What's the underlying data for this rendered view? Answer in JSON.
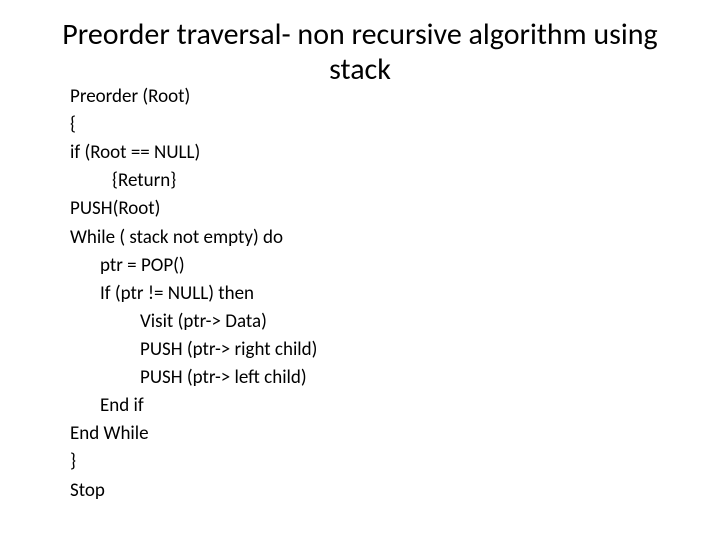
{
  "title": "Preorder traversal- non recursive algorithm using stack",
  "code": {
    "l1": "Preorder (Root)",
    "l2": "{",
    "l3": "if (Root == NULL)",
    "l4": "{Return}",
    "l5": "PUSH(Root)",
    "l6": "While ( stack not empty) do",
    "l7": "ptr = POP()",
    "l8": "If (ptr != NULL) then",
    "l9": "Visit (ptr-> Data)",
    "l10": "PUSH (ptr-> right child)",
    "l11": "PUSH (ptr-> left child)",
    "l12": "End if",
    "l13": "End While",
    "l14": "}",
    "l15": "Stop"
  }
}
